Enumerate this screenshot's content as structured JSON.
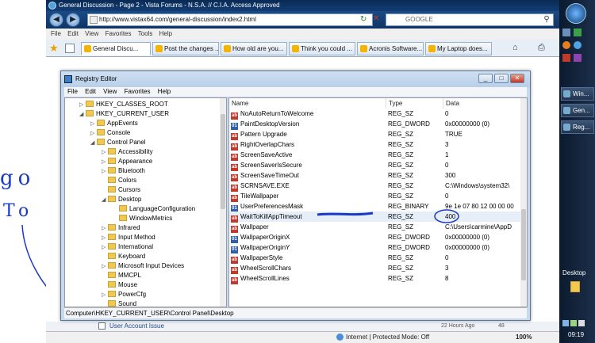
{
  "browser": {
    "title": "General Discussion - Page 2 - Vista Forums - N.S.A. // C.I.A. Access Approved",
    "url": "http://www.vistax64.com/general-discussion/index2.html",
    "search_placeholder": "GOOGLE",
    "menu": [
      "File",
      "Edit",
      "View",
      "Favorites",
      "Tools",
      "Help"
    ],
    "tabs": [
      "General Discu...",
      "Post the changes ...",
      "How old are you...",
      "Think you could ...",
      "Acronis Software...",
      "My Laptop does..."
    ],
    "status_text": "Internet | Protected Mode: Off",
    "zoom": "100%",
    "forum_row": {
      "title": "User Account Issue",
      "time": "22 Hours Ago",
      "count": "48"
    }
  },
  "regedit": {
    "title": "Registry Editor",
    "menu": [
      "File",
      "Edit",
      "View",
      "Favorites",
      "Help"
    ],
    "tree": [
      {
        "label": "HKEY_CLASSES_ROOT"
      },
      {
        "label": "HKEY_CURRENT_USER"
      },
      {
        "label": "AppEvents"
      },
      {
        "label": "Console"
      },
      {
        "label": "Control Panel"
      },
      {
        "label": "Accessibility"
      },
      {
        "label": "Appearance"
      },
      {
        "label": "Bluetooth"
      },
      {
        "label": "Colors"
      },
      {
        "label": "Cursors"
      },
      {
        "label": "Desktop"
      },
      {
        "label": "LanguageConfiguration"
      },
      {
        "label": "WindowMetrics"
      },
      {
        "label": "Infrared"
      },
      {
        "label": "Input Method"
      },
      {
        "label": "International"
      },
      {
        "label": "Keyboard"
      },
      {
        "label": "Microsoft Input Devices"
      },
      {
        "label": "MMCPL"
      },
      {
        "label": "Mouse"
      },
      {
        "label": "PowerCfg"
      },
      {
        "label": "Sound"
      }
    ],
    "columns": [
      "Name",
      "Type",
      "Data"
    ],
    "values": [
      {
        "name": "NoAutoReturnToWelcome",
        "type": "REG_SZ",
        "data": "0"
      },
      {
        "name": "PaintDesktopVersion",
        "type": "REG_DWORD",
        "data": "0x00000000 (0)"
      },
      {
        "name": "Pattern Upgrade",
        "type": "REG_SZ",
        "data": "TRUE"
      },
      {
        "name": "RightOverlapChars",
        "type": "REG_SZ",
        "data": "3"
      },
      {
        "name": "ScreenSaveActive",
        "type": "REG_SZ",
        "data": "1"
      },
      {
        "name": "ScreenSaverIsSecure",
        "type": "REG_SZ",
        "data": "0"
      },
      {
        "name": "ScreenSaveTimeOut",
        "type": "REG_SZ",
        "data": "300"
      },
      {
        "name": "SCRNSAVE.EXE",
        "type": "REG_SZ",
        "data": "C:\\Windows\\system32\\"
      },
      {
        "name": "TileWallpaper",
        "type": "REG_SZ",
        "data": "0"
      },
      {
        "name": "UserPreferencesMask",
        "type": "REG_BINARY",
        "data": "9e 1e 07 80 12 00 00 00"
      },
      {
        "name": "WaitToKillAppTimeout",
        "type": "REG_SZ",
        "data": "400"
      },
      {
        "name": "Wallpaper",
        "type": "REG_SZ",
        "data": "C:\\Users\\carmine\\AppD"
      },
      {
        "name": "WallpaperOriginX",
        "type": "REG_DWORD",
        "data": "0x00000000 (0)"
      },
      {
        "name": "WallpaperOriginY",
        "type": "REG_DWORD",
        "data": "0x00000000 (0)"
      },
      {
        "name": "WallpaperStyle",
        "type": "REG_SZ",
        "data": "0"
      },
      {
        "name": "WheelScrollChars",
        "type": "REG_SZ",
        "data": "3"
      },
      {
        "name": "WheelScrollLines",
        "type": "REG_SZ",
        "data": "8"
      }
    ],
    "status_path": "Computer\\HKEY_CURRENT_USER\\Control Panel\\Desktop"
  },
  "annotation": {
    "line1": "go",
    "line2": "To"
  },
  "taskbar": {
    "items": [
      "Win...",
      "Gen...",
      "Reg..."
    ],
    "desktop_label": "Desktop",
    "clock": "09:19"
  }
}
